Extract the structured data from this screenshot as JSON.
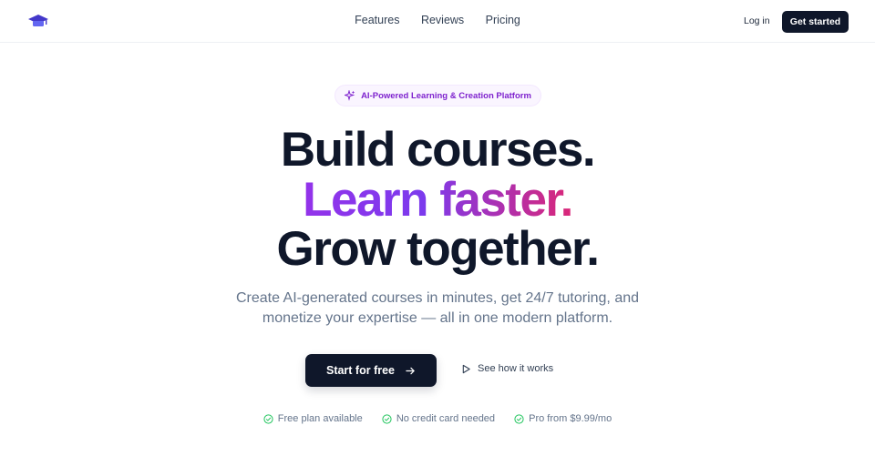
{
  "nav": {
    "logo_icon": "graduation-cap-icon",
    "links": [
      "Features",
      "Reviews",
      "Pricing"
    ],
    "login_label": "Log in",
    "get_started_label": "Get started"
  },
  "hero": {
    "badge_icon": "sparkles-icon",
    "badge_text": "AI-Powered Learning & Creation Platform",
    "headline_line1": "Build courses.",
    "headline_line2": "Learn faster.",
    "headline_line3": "Grow together.",
    "subtitle_line1": "Create AI-generated courses in minutes, get 24/7 tutoring, and",
    "subtitle_line2": "monetize your expertise — all in one modern platform.",
    "primary_cta_label": "Start for free",
    "primary_cta_icon": "arrow-right-icon",
    "secondary_cta_label": "See how it works",
    "secondary_cta_icon": "play-icon",
    "perks": [
      {
        "icon": "check-circle-icon",
        "label": "Free plan available"
      },
      {
        "icon": "check-circle-icon",
        "label": "No credit card needed"
      },
      {
        "icon": "check-circle-icon",
        "label": "Pro from $9.99/mo"
      }
    ]
  },
  "colors": {
    "primary_dark": "#0f172a",
    "accent_purple": "#7e22ce",
    "gradient_start": "#9333ea",
    "gradient_end": "#db2777",
    "check_green": "#22c55e",
    "muted_text": "#64748b"
  }
}
